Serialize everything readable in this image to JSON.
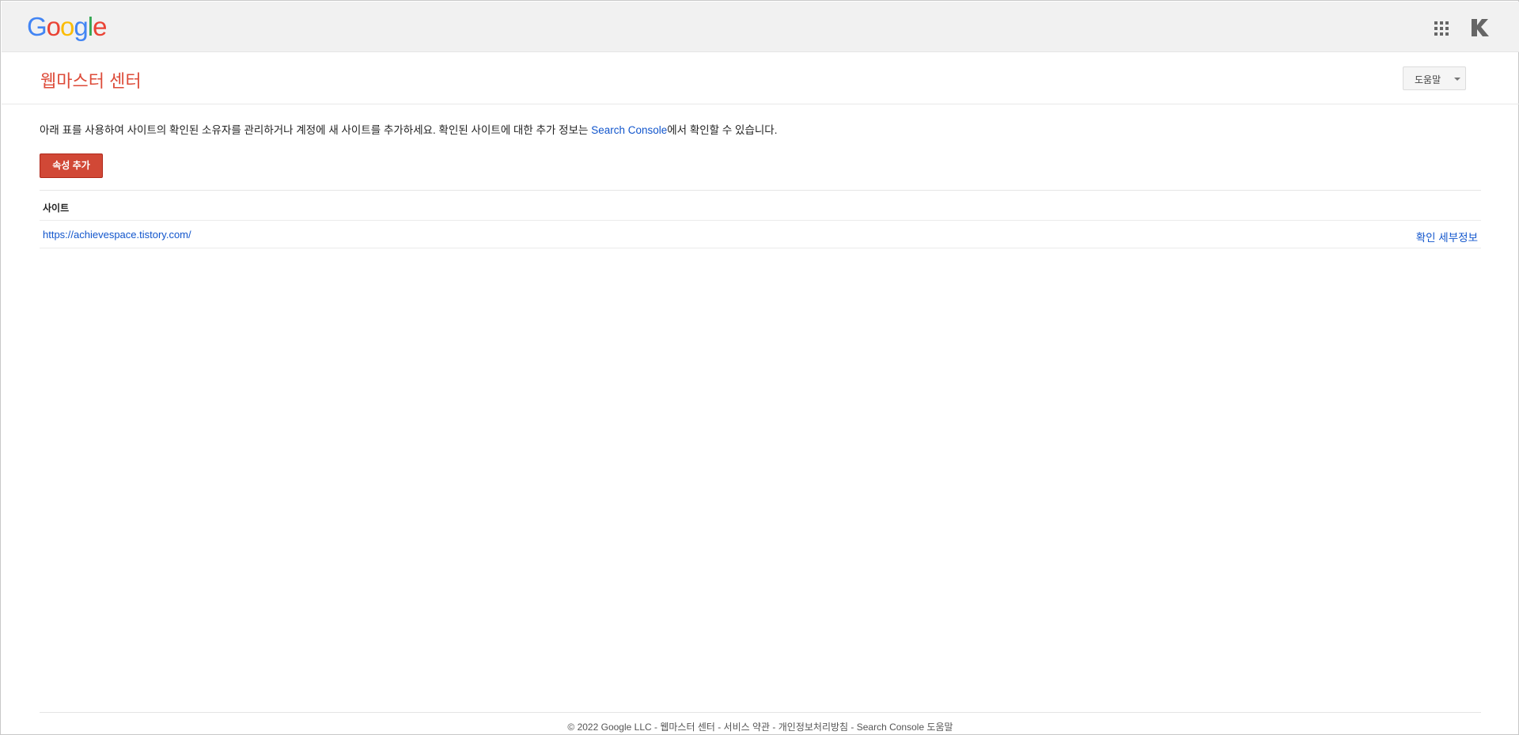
{
  "topbar": {
    "logo": [
      "G",
      "o",
      "o",
      "g",
      "l",
      "e"
    ],
    "apps_icon": "apps-grid-icon",
    "account_icon": "account-k-icon"
  },
  "header": {
    "title": "웹마스터 센터",
    "help_label": "도움말"
  },
  "intro": {
    "text_before": "아래 표를 사용하여 사이트의 확인된 소유자를 관리하거나 계정에 새 사이트를 추가하세요. 확인된 사이트에 대한 추가 정보는 ",
    "link_label": "Search Console",
    "text_after": "에서 확인할 수 있습니다."
  },
  "actions": {
    "add_property_label": "속성 추가"
  },
  "table": {
    "header_site": "사이트",
    "rows": [
      {
        "site": "https://achievespace.tistory.com/",
        "details_label": "확인 세부정보"
      }
    ]
  },
  "footer": {
    "text": "© 2022 Google LLC - 웹마스터 센터 - 서비스 약관 - 개인정보처리방침 - Search Console 도움말"
  },
  "colors": {
    "brand_red": "#dd4b39",
    "button_red": "#d14836",
    "link_blue": "#1155cc",
    "topbar_bg": "#f1f1f1"
  }
}
